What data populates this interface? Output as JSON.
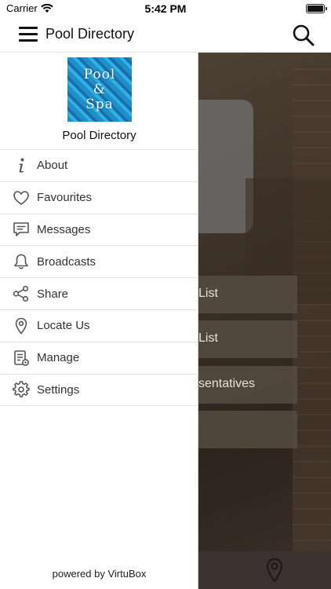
{
  "status_bar": {
    "carrier": "Carrier",
    "time": "5:42 PM"
  },
  "app_bar": {
    "title": "Pool Directory"
  },
  "drawer": {
    "logo_lines": [
      "Pool",
      "&",
      "Spa"
    ],
    "title": "Pool Directory",
    "items": [
      {
        "label": "About",
        "icon": "info-icon"
      },
      {
        "label": "Favourites",
        "icon": "heart-icon"
      },
      {
        "label": "Messages",
        "icon": "messages-icon"
      },
      {
        "label": "Broadcasts",
        "icon": "bell-icon"
      },
      {
        "label": "Share",
        "icon": "share-icon"
      },
      {
        "label": "Locate Us",
        "icon": "location-pin-icon"
      },
      {
        "label": "Manage",
        "icon": "manage-icon"
      },
      {
        "label": "Settings",
        "icon": "gear-icon"
      }
    ],
    "footer": "powered by VirtuBox"
  },
  "background_list": {
    "items": [
      "List",
      "List",
      "sentatives",
      ""
    ]
  }
}
